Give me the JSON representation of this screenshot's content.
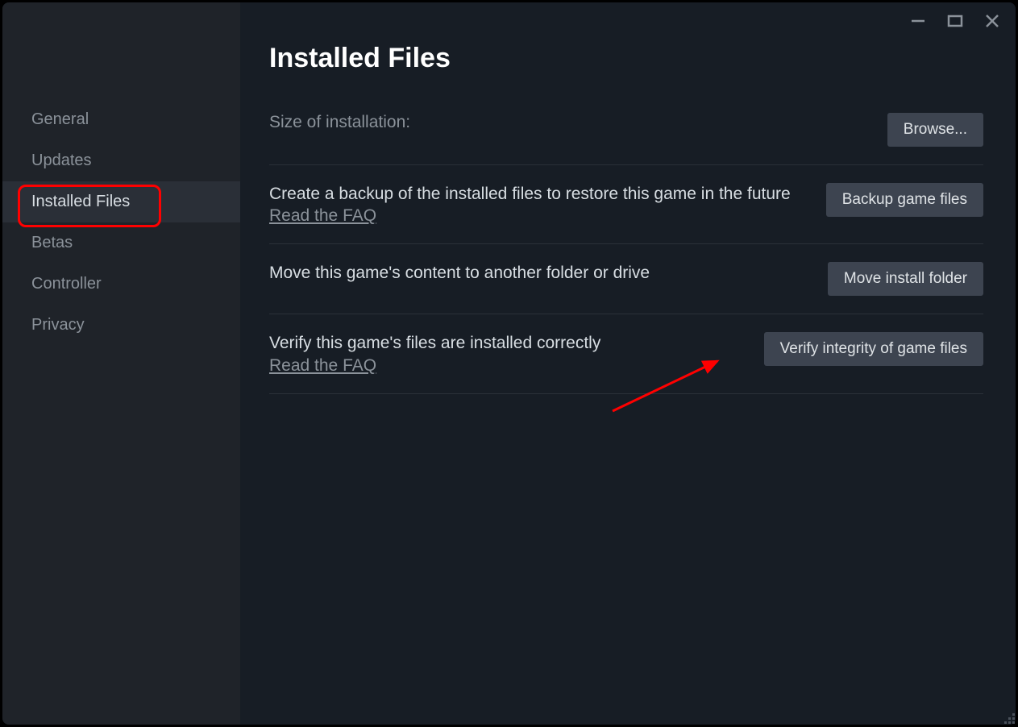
{
  "sidebar": {
    "items": [
      {
        "label": "General",
        "active": false
      },
      {
        "label": "Updates",
        "active": false
      },
      {
        "label": "Installed Files",
        "active": true
      },
      {
        "label": "Betas",
        "active": false
      },
      {
        "label": "Controller",
        "active": false
      },
      {
        "label": "Privacy",
        "active": false
      }
    ]
  },
  "main": {
    "title": "Installed Files",
    "rows": {
      "size": {
        "label": "Size of installation:",
        "button": "Browse..."
      },
      "backup": {
        "desc": "Create a backup of the installed files to restore this game in the future",
        "faq": "Read the FAQ",
        "button": "Backup game files"
      },
      "move": {
        "desc": "Move this game's content to another folder or drive",
        "button": "Move install folder"
      },
      "verify": {
        "desc": "Verify this game's files are installed correctly",
        "faq": "Read the FAQ",
        "button": "Verify integrity of game files"
      }
    }
  }
}
